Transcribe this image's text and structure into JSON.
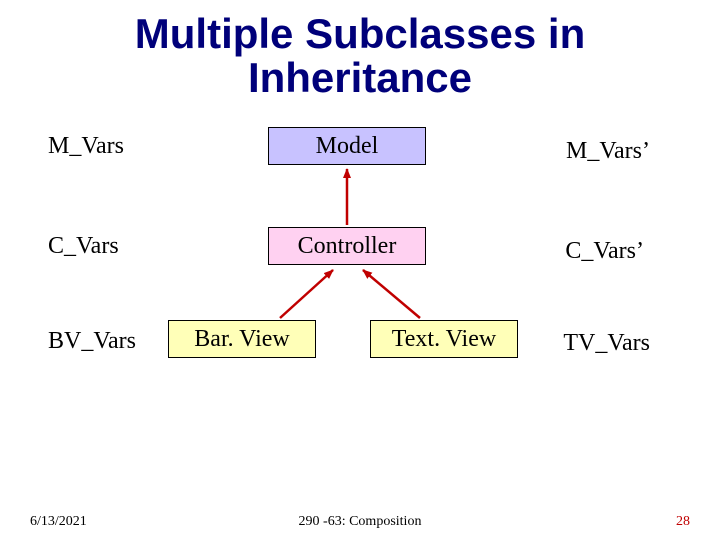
{
  "title_line1": "Multiple Subclasses in",
  "title_line2": "Inheritance",
  "labels": {
    "m_vars": "M_Vars",
    "c_vars": "C_Vars",
    "bv_vars": "BV_Vars",
    "m_vars_prime": "M_Vars’",
    "c_vars_prime": "C_Vars’",
    "tv_vars": "TV_Vars"
  },
  "boxes": {
    "model": "Model",
    "controller": "Controller",
    "bar_view": "Bar. View",
    "text_view": "Text. View"
  },
  "footer": {
    "date": "6/13/2021",
    "mid": "290 -63: Composition",
    "page": "28"
  },
  "colors": {
    "title": "#00007a",
    "model_fill": "#c8c2ff",
    "controller_fill": "#ffd1f1",
    "view_fill": "#ffffb8",
    "arrow": "#c00000",
    "page_number": "#c00000"
  }
}
